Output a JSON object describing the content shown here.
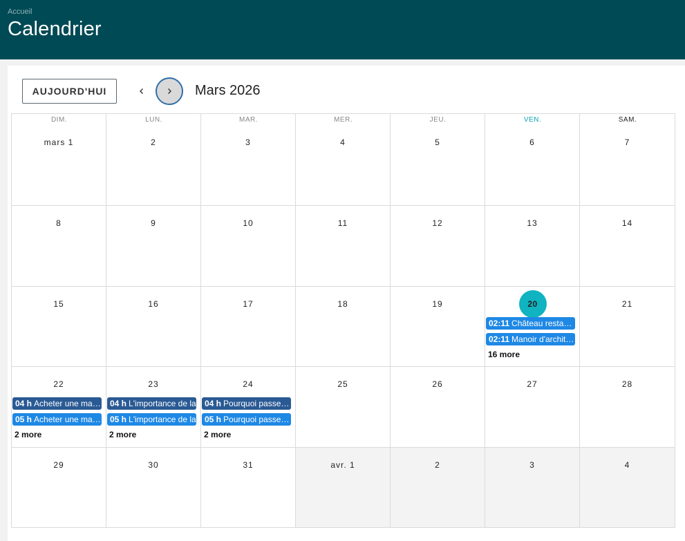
{
  "header": {
    "breadcrumb": "Accueil",
    "title": "Calendrier"
  },
  "toolbar": {
    "today_label": "AUJOURD'HUI",
    "month_title": "Mars 2026",
    "prev_icon": "chevron-left-icon",
    "next_icon": "chevron-right-icon"
  },
  "weekdays": [
    "DIM.",
    "LUN.",
    "MAR.",
    "MER.",
    "JEU.",
    "VEN.",
    "SAM."
  ],
  "weeks": [
    [
      "mars 1",
      "2",
      "3",
      "4",
      "5",
      "6",
      "7"
    ],
    [
      "8",
      "9",
      "10",
      "11",
      "12",
      "13",
      "14"
    ],
    [
      "15",
      "16",
      "17",
      "18",
      "19",
      "20",
      "21"
    ],
    [
      "22",
      "23",
      "24",
      "25",
      "26",
      "27",
      "28"
    ],
    [
      "29",
      "30",
      "31",
      "avr. 1",
      "2",
      "3",
      "4"
    ]
  ],
  "events": {
    "w2d5": [
      {
        "time": "02:11",
        "title": "Château restauré",
        "style": "light"
      },
      {
        "time": "02:11",
        "title": "Manoir d'architecte",
        "style": "light"
      }
    ],
    "w2d5_more": "16 more",
    "w3d0": [
      {
        "time": "04 h",
        "title": "Acheter une maison",
        "style": "dark"
      },
      {
        "time": "05 h",
        "title": "Acheter une maison",
        "style": "light"
      }
    ],
    "w3d0_more": "2 more",
    "w3d1": [
      {
        "time": "04 h",
        "title": "L'importance de la",
        "style": "dark"
      },
      {
        "time": "05 h",
        "title": "L'importance de la",
        "style": "light"
      }
    ],
    "w3d1_more": "2 more",
    "w3d2": [
      {
        "time": "04 h",
        "title": "Pourquoi passer par",
        "style": "dark"
      },
      {
        "time": "05 h",
        "title": "Pourquoi passer par",
        "style": "light"
      }
    ],
    "w3d2_more": "2 more"
  },
  "colors": {
    "header_bg": "#004a55",
    "today_accent": "#10b3c0",
    "event_dark": "#2a5a94",
    "event_light": "#1e88e5"
  }
}
